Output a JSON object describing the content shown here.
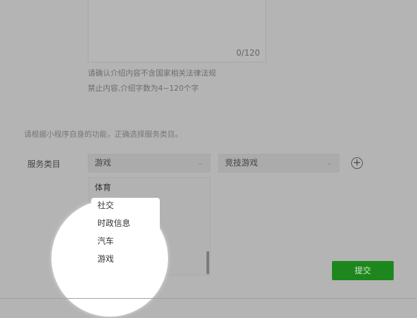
{
  "intro": {
    "counter": "0/120",
    "help": [
      "请确认介绍内容不含国家相关法律法规",
      "禁止内容,介绍字数为4~120个字"
    ]
  },
  "service": {
    "hint": "请根据小程序自身的功能，正确选择服务类目。",
    "label": "服务类目",
    "primary_value": "游戏",
    "secondary_value": "竞技游戏",
    "options": [
      "体育",
      "社交",
      "时政信息",
      "汽车",
      "游戏"
    ]
  },
  "submit_label": "提交"
}
